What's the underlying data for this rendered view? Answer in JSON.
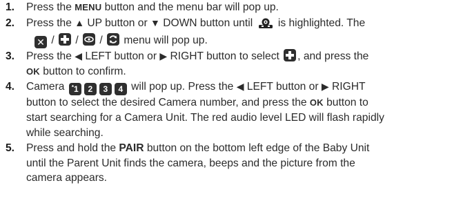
{
  "steps": [
    {
      "num": "1.",
      "t1": "Press the ",
      "menu": "MENU",
      "t2": " button and the menu bar will pop up."
    },
    {
      "num": "2.",
      "t1": "Press the ",
      "up": "▲",
      "t2": " UP button or ",
      "down": "▼",
      "t3": " DOWN button until ",
      "t4": " is highlighted. The",
      "slash": "/",
      "t5": " menu will pop up."
    },
    {
      "num": "3.",
      "t1": "Press the ",
      "left": "◀",
      "t2": " LEFT button or ",
      "right": "▶",
      "t3": " RIGHT button to select ",
      "t4": ", and press the",
      "ok": "OK",
      "t5": " button to confirm."
    },
    {
      "num": "4.",
      "t1": "Camera ",
      "cams": [
        "1",
        "2",
        "3",
        "4"
      ],
      "star": "*",
      "t2": " will pop up. Press the ",
      "left": "◀",
      "t3": " LEFT button or ",
      "right": "▶",
      "t4": " RIGHT",
      "t5": "button to select the desired Camera number, and press the ",
      "ok": "OK",
      "t6": " button to",
      "t7": "start searching for a Camera Unit. The red audio level LED will flash rapidly",
      "t8": "while searching."
    },
    {
      "num": "5.",
      "t1": "Press and hold the ",
      "pair": "PAIR",
      "t2": " button on the bottom left edge of the Baby Unit",
      "t3": "until the Parent Unit finds the camera, beeps and the picture from the",
      "t4": "camera appears."
    }
  ],
  "icons": [
    "camera-icon",
    "delete-x-icon",
    "add-plus-icon",
    "view-eye-icon",
    "scan-cycle-icon"
  ],
  "colors": {
    "text": "#2b2b2b",
    "icon_bg": "#2f2f2f",
    "icon_fg": "#ffffff"
  }
}
